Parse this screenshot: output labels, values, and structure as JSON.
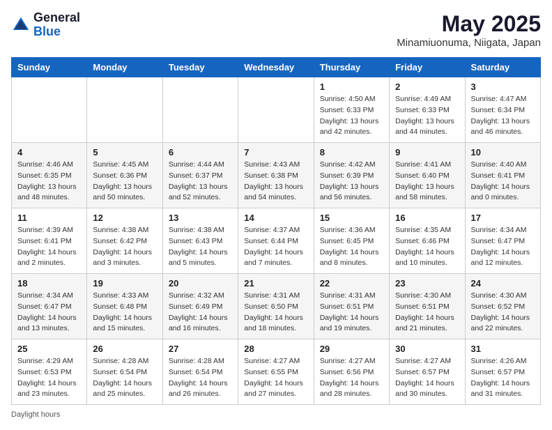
{
  "header": {
    "logo_general": "General",
    "logo_blue": "Blue",
    "title": "May 2025",
    "subtitle": "Minamiuonuma, Niigata, Japan"
  },
  "footer": {
    "daylight_label": "Daylight hours"
  },
  "days_of_week": [
    "Sunday",
    "Monday",
    "Tuesday",
    "Wednesday",
    "Thursday",
    "Friday",
    "Saturday"
  ],
  "weeks": [
    [
      {
        "day": "",
        "info": ""
      },
      {
        "day": "",
        "info": ""
      },
      {
        "day": "",
        "info": ""
      },
      {
        "day": "",
        "info": ""
      },
      {
        "day": "1",
        "info": "Sunrise: 4:50 AM\nSunset: 6:33 PM\nDaylight: 13 hours and 42 minutes."
      },
      {
        "day": "2",
        "info": "Sunrise: 4:49 AM\nSunset: 6:33 PM\nDaylight: 13 hours and 44 minutes."
      },
      {
        "day": "3",
        "info": "Sunrise: 4:47 AM\nSunset: 6:34 PM\nDaylight: 13 hours and 46 minutes."
      }
    ],
    [
      {
        "day": "4",
        "info": "Sunrise: 4:46 AM\nSunset: 6:35 PM\nDaylight: 13 hours and 48 minutes."
      },
      {
        "day": "5",
        "info": "Sunrise: 4:45 AM\nSunset: 6:36 PM\nDaylight: 13 hours and 50 minutes."
      },
      {
        "day": "6",
        "info": "Sunrise: 4:44 AM\nSunset: 6:37 PM\nDaylight: 13 hours and 52 minutes."
      },
      {
        "day": "7",
        "info": "Sunrise: 4:43 AM\nSunset: 6:38 PM\nDaylight: 13 hours and 54 minutes."
      },
      {
        "day": "8",
        "info": "Sunrise: 4:42 AM\nSunset: 6:39 PM\nDaylight: 13 hours and 56 minutes."
      },
      {
        "day": "9",
        "info": "Sunrise: 4:41 AM\nSunset: 6:40 PM\nDaylight: 13 hours and 58 minutes."
      },
      {
        "day": "10",
        "info": "Sunrise: 4:40 AM\nSunset: 6:41 PM\nDaylight: 14 hours and 0 minutes."
      }
    ],
    [
      {
        "day": "11",
        "info": "Sunrise: 4:39 AM\nSunset: 6:41 PM\nDaylight: 14 hours and 2 minutes."
      },
      {
        "day": "12",
        "info": "Sunrise: 4:38 AM\nSunset: 6:42 PM\nDaylight: 14 hours and 3 minutes."
      },
      {
        "day": "13",
        "info": "Sunrise: 4:38 AM\nSunset: 6:43 PM\nDaylight: 14 hours and 5 minutes."
      },
      {
        "day": "14",
        "info": "Sunrise: 4:37 AM\nSunset: 6:44 PM\nDaylight: 14 hours and 7 minutes."
      },
      {
        "day": "15",
        "info": "Sunrise: 4:36 AM\nSunset: 6:45 PM\nDaylight: 14 hours and 8 minutes."
      },
      {
        "day": "16",
        "info": "Sunrise: 4:35 AM\nSunset: 6:46 PM\nDaylight: 14 hours and 10 minutes."
      },
      {
        "day": "17",
        "info": "Sunrise: 4:34 AM\nSunset: 6:47 PM\nDaylight: 14 hours and 12 minutes."
      }
    ],
    [
      {
        "day": "18",
        "info": "Sunrise: 4:34 AM\nSunset: 6:47 PM\nDaylight: 14 hours and 13 minutes."
      },
      {
        "day": "19",
        "info": "Sunrise: 4:33 AM\nSunset: 6:48 PM\nDaylight: 14 hours and 15 minutes."
      },
      {
        "day": "20",
        "info": "Sunrise: 4:32 AM\nSunset: 6:49 PM\nDaylight: 14 hours and 16 minutes."
      },
      {
        "day": "21",
        "info": "Sunrise: 4:31 AM\nSunset: 6:50 PM\nDaylight: 14 hours and 18 minutes."
      },
      {
        "day": "22",
        "info": "Sunrise: 4:31 AM\nSunset: 6:51 PM\nDaylight: 14 hours and 19 minutes."
      },
      {
        "day": "23",
        "info": "Sunrise: 4:30 AM\nSunset: 6:51 PM\nDaylight: 14 hours and 21 minutes."
      },
      {
        "day": "24",
        "info": "Sunrise: 4:30 AM\nSunset: 6:52 PM\nDaylight: 14 hours and 22 minutes."
      }
    ],
    [
      {
        "day": "25",
        "info": "Sunrise: 4:29 AM\nSunset: 6:53 PM\nDaylight: 14 hours and 23 minutes."
      },
      {
        "day": "26",
        "info": "Sunrise: 4:28 AM\nSunset: 6:54 PM\nDaylight: 14 hours and 25 minutes."
      },
      {
        "day": "27",
        "info": "Sunrise: 4:28 AM\nSunset: 6:54 PM\nDaylight: 14 hours and 26 minutes."
      },
      {
        "day": "28",
        "info": "Sunrise: 4:27 AM\nSunset: 6:55 PM\nDaylight: 14 hours and 27 minutes."
      },
      {
        "day": "29",
        "info": "Sunrise: 4:27 AM\nSunset: 6:56 PM\nDaylight: 14 hours and 28 minutes."
      },
      {
        "day": "30",
        "info": "Sunrise: 4:27 AM\nSunset: 6:57 PM\nDaylight: 14 hours and 30 minutes."
      },
      {
        "day": "31",
        "info": "Sunrise: 4:26 AM\nSunset: 6:57 PM\nDaylight: 14 hours and 31 minutes."
      }
    ]
  ]
}
